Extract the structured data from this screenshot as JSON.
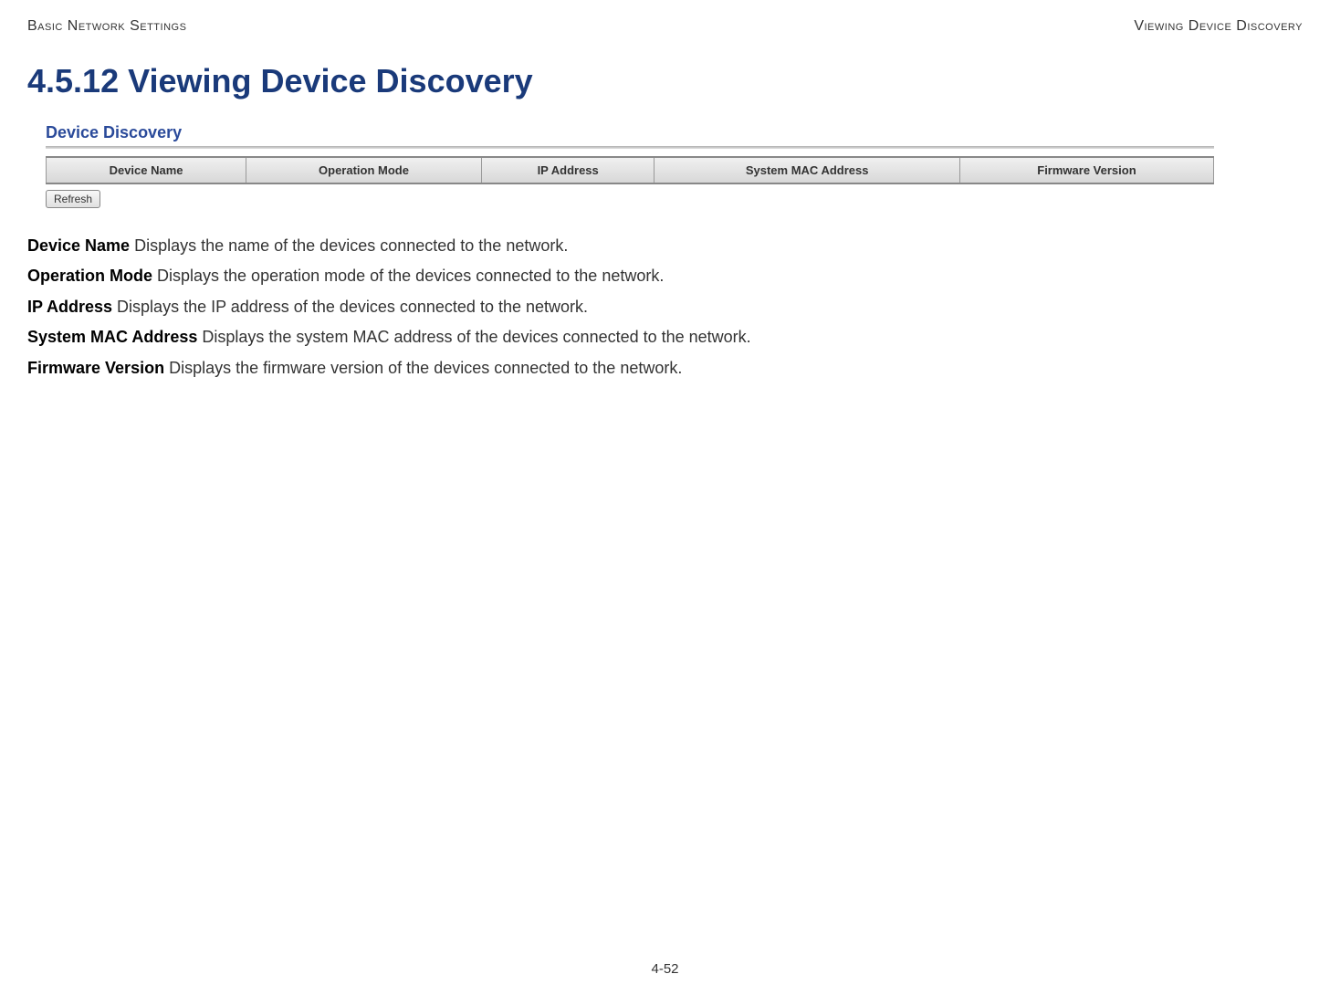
{
  "header": {
    "left": "Basic Network Settings",
    "right": "Viewing Device Discovery"
  },
  "section_title": "4.5.12 Viewing Device Discovery",
  "panel": {
    "title": "Device Discovery",
    "columns": [
      "Device Name",
      "Operation Mode",
      "IP Address",
      "System MAC Address",
      "Firmware Version"
    ],
    "refresh_label": "Refresh"
  },
  "definitions": [
    {
      "term": "Device Name",
      "desc": "  Displays the name of the devices connected to the network."
    },
    {
      "term": "Operation Mode",
      "desc": "  Displays the operation mode of the devices connected to the network."
    },
    {
      "term": "IP Address",
      "desc": "  Displays the IP address of the devices connected to the network."
    },
    {
      "term": "System MAC Address",
      "desc": "  Displays the system MAC address of the devices connected to the network."
    },
    {
      "term": "Firmware Version",
      "desc": "  Displays the firmware version of the devices connected to the network."
    }
  ],
  "page_number": "4-52"
}
